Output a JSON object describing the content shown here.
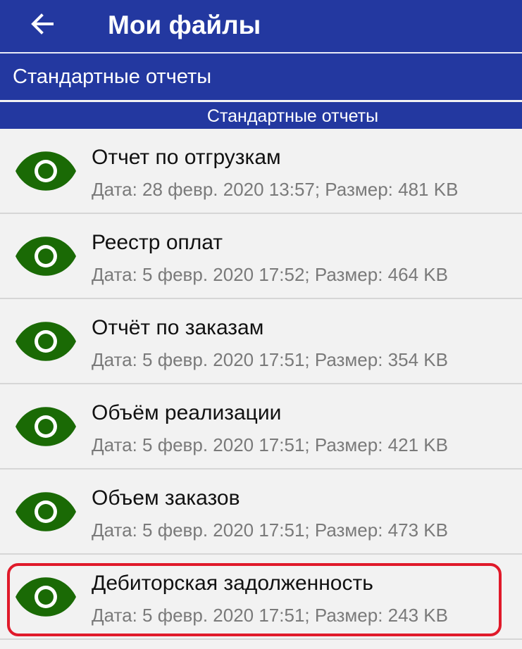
{
  "appbar": {
    "back_icon": "arrow-left-icon",
    "title": "Мои файлы"
  },
  "section": {
    "label": "Стандартные отчеты"
  },
  "group_header": {
    "label": "Стандартные отчеты"
  },
  "colors": {
    "primary": "#2338a0",
    "icon_green": "#1a6a05",
    "highlight_red": "#e01a2a"
  },
  "files": [
    {
      "icon": "eye-icon",
      "title": "Отчет по отгрузкам",
      "meta": "Дата: 28 февр. 2020 13:57; Размер: 481 KB"
    },
    {
      "icon": "eye-icon",
      "title": "Реестр оплат",
      "meta": "Дата: 5 февр. 2020 17:52; Размер: 464 KB"
    },
    {
      "icon": "eye-icon",
      "title": "Отчёт по заказам",
      "meta": "Дата: 5 февр. 2020 17:51; Размер: 354 KB"
    },
    {
      "icon": "eye-icon",
      "title": "Объём реализации",
      "meta": "Дата: 5 февр. 2020 17:51; Размер: 421 KB"
    },
    {
      "icon": "eye-icon",
      "title": "Объем заказов",
      "meta": "Дата: 5 февр. 2020 17:51; Размер: 473 KB"
    },
    {
      "icon": "eye-icon",
      "title": "Дебиторская задолженность",
      "meta": "Дата: 5 февр. 2020 17:51; Размер: 243 KB"
    }
  ]
}
